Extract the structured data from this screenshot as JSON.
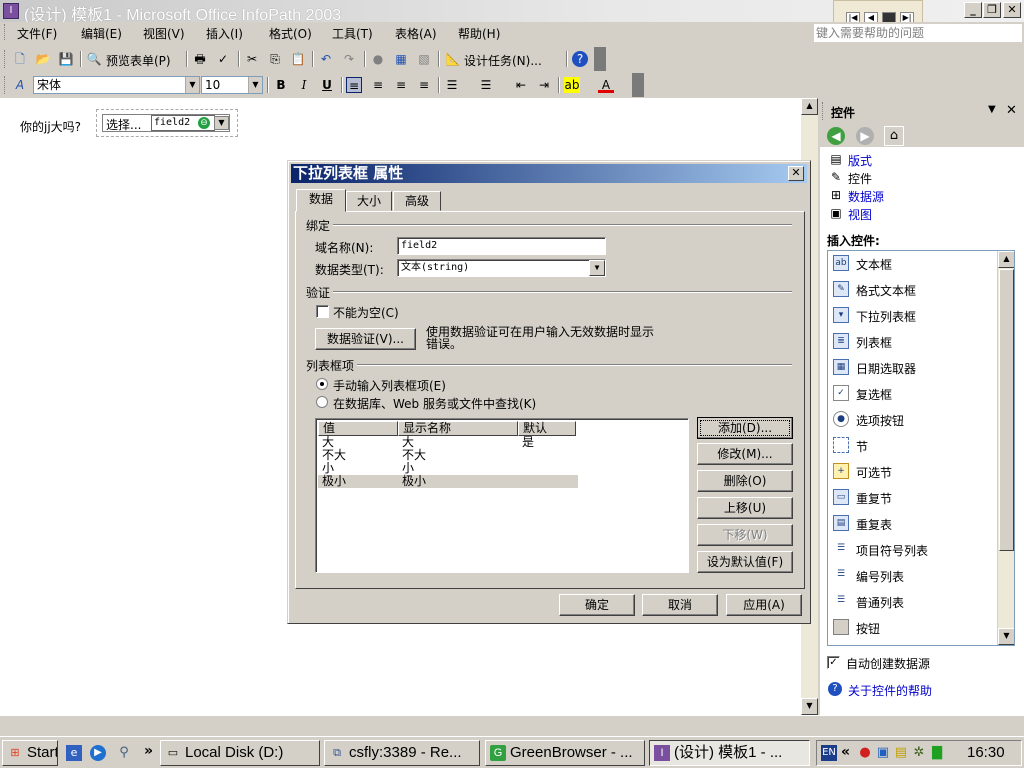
{
  "window": {
    "title": "(设计) 模板1 - Microsoft Office InfoPath 2003",
    "help_placeholder": "键入需要帮助的问题"
  },
  "menu": [
    "文件(F)",
    "编辑(E)",
    "视图(V)",
    "插入(I)",
    "格式(O)",
    "工具(T)",
    "表格(A)",
    "帮助(H)"
  ],
  "toolbar": {
    "preview_label": "预览表单(P)",
    "design_tasks_label": "设计任务(N)...",
    "font_name": "宋体",
    "font_size": "10"
  },
  "document": {
    "question_label": "你的jj大吗?",
    "dropdown_display": "选择...",
    "field_badge": "field2"
  },
  "taskpane": {
    "title": "控件",
    "links": [
      "版式",
      "控件",
      "数据源",
      "视图"
    ],
    "insert_label": "插入控件:",
    "controls": [
      "文本框",
      "格式文本框",
      "下拉列表框",
      "列表框",
      "日期选取器",
      "复选框",
      "选项按钮",
      "节",
      "可选节",
      "重复节",
      "重复表",
      "项目符号列表",
      "编号列表",
      "普通列表",
      "按钮"
    ],
    "auto_create_label": "自动创建数据源",
    "help_link": "关于控件的帮助"
  },
  "dialog": {
    "title": "下拉列表框 属性",
    "tabs": [
      "数据",
      "大小",
      "高级"
    ],
    "binding_group": "绑定",
    "field_name_label": "域名称(N):",
    "field_name_value": "field2",
    "data_type_label": "数据类型(T):",
    "data_type_value": "文本(string)",
    "validation_group": "验证",
    "not_blank_label": "不能为空(C)",
    "validation_button": "数据验证(V)...",
    "validation_hint": "使用数据验证可在用户输入无效数据时显示错误。",
    "list_group": "列表框项",
    "radio_manual": "手动输入列表框项(E)",
    "radio_lookup": "在数据库、Web 服务或文件中查找(K)",
    "columns": [
      "值",
      "显示名称",
      "默认"
    ],
    "rows": [
      {
        "value": "大",
        "display": "大",
        "default": "是"
      },
      {
        "value": "不大",
        "display": "不大",
        "default": ""
      },
      {
        "value": "小",
        "display": "小",
        "default": ""
      },
      {
        "value": "极小",
        "display": "极小",
        "default": ""
      }
    ],
    "buttons": {
      "add": "添加(D)...",
      "modify": "修改(M)...",
      "delete": "删除(O)",
      "move_up": "上移(U)",
      "move_down": "下移(W)",
      "set_default": "设为默认值(F)"
    },
    "ok": "确定",
    "cancel": "取消",
    "apply": "应用(A)"
  },
  "taskbar": {
    "start": "Start",
    "tasks": [
      "Local Disk (D:)",
      "csfly:3389 - Re...",
      "GreenBrowser - ...",
      "(设计) 模板1 - ..."
    ],
    "lang": "EN",
    "clock": "16:30"
  }
}
